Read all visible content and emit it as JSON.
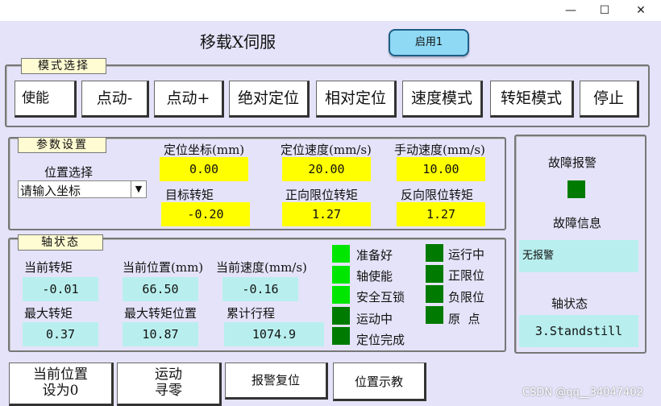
{
  "window": {
    "title": "移载X伺服",
    "enable_label": "启用1",
    "controls": {
      "minimize": "—",
      "maximize": "☐",
      "close": "✕"
    }
  },
  "mode": {
    "label": "模式选择",
    "buttons": [
      "使能",
      "点动-",
      "点动+",
      "绝对定位",
      "相对定位",
      "速度模式",
      "转矩模式",
      "停止"
    ]
  },
  "params": {
    "label": "参数设置",
    "position_select_label": "位置选择",
    "position_select_value": "请输入坐标",
    "fields": {
      "pos_coord": {
        "label": "定位坐标(mm)",
        "value": "0.00"
      },
      "pos_speed": {
        "label": "定位速度(mm/s)",
        "value": "20.00"
      },
      "manual_speed": {
        "label": "手动速度(mm/s)",
        "value": "10.00"
      },
      "target_torque": {
        "label": "目标转矩",
        "value": "-0.20"
      },
      "fwd_limit_torque": {
        "label": "正向限位转矩",
        "value": "1.27"
      },
      "rev_limit_torque": {
        "label": "反向限位转矩",
        "value": "1.27"
      }
    }
  },
  "axis": {
    "label": "轴状态",
    "current_torque": {
      "label": "当前转矩",
      "value": "-0.01"
    },
    "current_pos": {
      "label": "当前位置(mm)",
      "value": "66.50"
    },
    "current_speed": {
      "label": "当前速度(mm/s)",
      "value": "-0.16"
    },
    "max_torque": {
      "label": "最大转矩",
      "value": "0.37"
    },
    "max_torque_pos": {
      "label": "最大转矩位置",
      "value": "10.87"
    },
    "travel": {
      "label": "累计行程",
      "value": "1074.9"
    },
    "status_left": [
      "准备好",
      "轴使能",
      "安全互锁",
      "运动中",
      "定位完成"
    ],
    "status_right": [
      "运行中",
      "正限位",
      "负限位",
      "原  点"
    ]
  },
  "fault": {
    "alarm_label": "故障报警",
    "info_label": "故障信息",
    "info_value": "无报警",
    "axis_state_label": "轴状态",
    "axis_state_value": "3.Standstill"
  },
  "bottom": {
    "set_zero": [
      "当前位置",
      "设为0"
    ],
    "home": [
      "运动",
      "寻零"
    ],
    "alarm_reset": "报警复位",
    "teach": "位置示教"
  },
  "watermark": "CSDN @qq__34047402"
}
